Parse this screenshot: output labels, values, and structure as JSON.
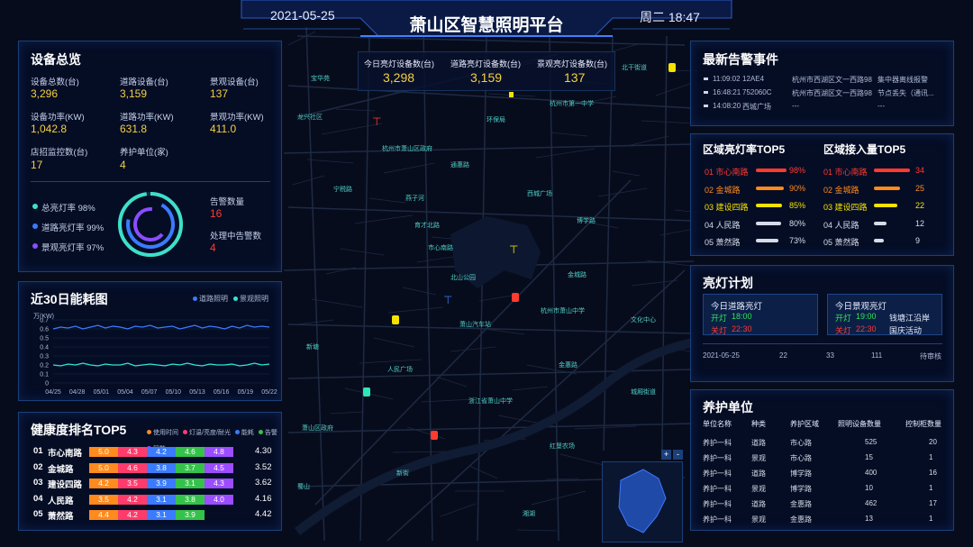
{
  "header": {
    "date": "2021-05-25",
    "title": "萧山区智慧照明平台",
    "weekday_time": "周二 18:47"
  },
  "top_stats": [
    {
      "label": "今日亮灯设备数(台)",
      "value": "3,298"
    },
    {
      "label": "道路亮灯设备数(台)",
      "value": "3,159"
    },
    {
      "label": "景观亮灯设备数(台)",
      "value": "137"
    }
  ],
  "device_overview": {
    "title": "设备总览",
    "items": [
      {
        "label": "设备总数(台)",
        "value": "3,296"
      },
      {
        "label": "道路设备(台)",
        "value": "3,159"
      },
      {
        "label": "景观设备(台)",
        "value": "137"
      },
      {
        "label": "设备功率(KW)",
        "value": "1,042.8"
      },
      {
        "label": "道路功率(KW)",
        "value": "631.8"
      },
      {
        "label": "景观功率(KW)",
        "value": "411.0"
      },
      {
        "label": "店招监控数(台)",
        "value": "17"
      },
      {
        "label": "养护单位(家)",
        "value": "4"
      }
    ],
    "rates": [
      {
        "label": "总亮灯率 98%",
        "color": "#3de0c8"
      },
      {
        "label": "道路亮灯率 99%",
        "color": "#3a7bff"
      },
      {
        "label": "景观亮灯率 97%",
        "color": "#8a4dff"
      }
    ],
    "alarm_count_label": "告警数量",
    "alarm_count": "16",
    "alarm_pending_label": "处理中告警数",
    "alarm_pending": "4"
  },
  "energy": {
    "title": "近30日能耗图",
    "legend": [
      {
        "name": "道路照明",
        "color": "#3a7bff"
      },
      {
        "name": "景观照明",
        "color": "#2ee6d6"
      }
    ],
    "unit": "万(KW)"
  },
  "chart_data": {
    "type": "line",
    "ylabel": "万(KW)",
    "ylim": [
      0,
      0.7
    ],
    "y_ticks": [
      "0.7",
      "0.6",
      "0.5",
      "0.4",
      "0.3",
      "0.2",
      "0.1",
      "0"
    ],
    "x": [
      "04/25",
      "04/28",
      "05/01",
      "05/04",
      "05/07",
      "05/10",
      "05/13",
      "05/16",
      "05/19",
      "05/22"
    ],
    "series": [
      {
        "name": "道路照明",
        "color": "#3a7bff",
        "values": [
          0.6,
          0.62,
          0.61,
          0.63,
          0.6,
          0.62,
          0.64,
          0.61,
          0.63,
          0.62,
          0.6,
          0.63,
          0.62,
          0.64,
          0.61,
          0.62,
          0.63,
          0.6,
          0.62,
          0.64,
          0.61,
          0.63,
          0.62,
          0.6,
          0.63,
          0.61,
          0.64,
          0.62,
          0.63,
          0.62
        ]
      },
      {
        "name": "景观照明",
        "color": "#2ee6d6",
        "values": [
          0.2,
          0.19,
          0.21,
          0.2,
          0.22,
          0.2,
          0.19,
          0.21,
          0.2,
          0.2,
          0.22,
          0.19,
          0.2,
          0.21,
          0.2,
          0.19,
          0.21,
          0.2,
          0.22,
          0.2,
          0.19,
          0.21,
          0.2,
          0.2,
          0.21,
          0.19,
          0.2,
          0.22,
          0.2,
          0.21
        ]
      }
    ]
  },
  "health": {
    "title": "健康度排名TOP5",
    "legend": [
      {
        "name": "使用时间",
        "color": "#ff8a1d"
      },
      {
        "name": "灯温/亮度/耐光",
        "color": "#ff3b6b"
      },
      {
        "name": "能耗",
        "color": "#3a7bff"
      },
      {
        "name": "告警",
        "color": "#35c24a"
      },
      {
        "name": "智能",
        "color": "#9b4dff"
      }
    ],
    "rows": [
      {
        "rank": "01",
        "name": "市心南路",
        "segs": [
          "5.0",
          "4.3",
          "4.2",
          "4.6",
          "4.8"
        ],
        "score": "4.30"
      },
      {
        "rank": "02",
        "name": "金城路",
        "segs": [
          "5.0",
          "4.6",
          "3.8",
          "3.7",
          "4.5"
        ],
        "score": "3.52"
      },
      {
        "rank": "03",
        "name": "建设四路",
        "segs": [
          "4.2",
          "3.5",
          "3.9",
          "3.1",
          "4.3"
        ],
        "score": "3.62"
      },
      {
        "rank": "04",
        "name": "人民路",
        "segs": [
          "3.5",
          "4.2",
          "3.1",
          "3.8",
          "4.0"
        ],
        "score": "4.16"
      },
      {
        "rank": "05",
        "name": "萧然路",
        "segs": [
          "4.4",
          "4.2",
          "3.1",
          "3.9",
          ""
        ],
        "score": "4.42"
      }
    ]
  },
  "alarms": {
    "title": "最新告警事件",
    "rows": [
      {
        "time": "11:09:02",
        "code": "12AE4",
        "addr": "杭州市西湖区文一西路98",
        "desc": "集中器离线报警"
      },
      {
        "time": "16:48:21",
        "code": "752060C",
        "addr": "杭州市西湖区文一西路98",
        "desc": "节点丢失（通讯..."
      },
      {
        "time": "14:08:20",
        "code": "西城广场",
        "addr": "---",
        "desc": "---"
      }
    ]
  },
  "region_light": {
    "title": "区域亮灯率TOP5",
    "rows": [
      {
        "name": "01 市心南路",
        "value": "98%",
        "c": "red"
      },
      {
        "name": "02 金城路",
        "value": "90%",
        "c": "org"
      },
      {
        "name": "03 建设四路",
        "value": "85%",
        "c": "yel"
      },
      {
        "name": "04 人民路",
        "value": "80%",
        "c": "wht"
      },
      {
        "name": "05 萧然路",
        "value": "73%",
        "c": "wht"
      }
    ]
  },
  "region_access": {
    "title": "区域接入量TOP5",
    "rows": [
      {
        "name": "01 市心南路",
        "value": "34",
        "c": "red"
      },
      {
        "name": "02 金城路",
        "value": "25",
        "c": "org"
      },
      {
        "name": "03 建设四路",
        "value": "22",
        "c": "yel"
      },
      {
        "name": "04 人民路",
        "value": "12",
        "c": "wht"
      },
      {
        "name": "05 萧然路",
        "value": "9",
        "c": "wht"
      }
    ]
  },
  "plan": {
    "title": "亮灯计划",
    "road": {
      "title": "今日道路亮灯",
      "on_label": "开灯",
      "on": "18:00",
      "off_label": "关灯",
      "off": "22:30"
    },
    "scenic": {
      "title": "今日景观亮灯",
      "on_label": "开灯",
      "on": "19:00",
      "off_label": "关灯",
      "off": "22:30",
      "note1": "钱塘江沿岸",
      "note2": "国庆活动"
    },
    "row": {
      "date": "2021-05-25",
      "a": "22",
      "b": "33",
      "c": "111",
      "status": "待审核"
    }
  },
  "maint": {
    "title": "养护单位",
    "headers": [
      "单位名称",
      "种类",
      "养护区域",
      "照明设备数量",
      "控制柜数量"
    ],
    "rows": [
      [
        "养护一科",
        "道路",
        "市心路",
        "525",
        "20"
      ],
      [
        "养护一科",
        "景观",
        "市心路",
        "15",
        "1"
      ],
      [
        "养护一科",
        "道路",
        "博学路",
        "400",
        "16"
      ],
      [
        "养护一科",
        "景观",
        "博学路",
        "10",
        "1"
      ],
      [
        "养护一科",
        "道路",
        "金惠路",
        "462",
        "17"
      ],
      [
        "养护一科",
        "景观",
        "金惠路",
        "13",
        "1"
      ]
    ]
  },
  "map_labels": [
    "宝华苑",
    "龙兴社区",
    "环保局",
    "杭州市萧山区政府",
    "通惠路",
    "宁税路",
    "西城广场",
    "燕子河",
    "育才北路",
    "市心南路",
    "北山公园",
    "金城路",
    "杭州市萧山中学",
    "萧山汽车站",
    "人民广场",
    "文化中心",
    "新塘",
    "浙江省萧山中学",
    "红垦农场",
    "新街",
    "萧山区政府",
    "蜀山",
    "湘湖",
    "博学路",
    "金惠路",
    "城厢街道",
    "北干街道",
    "杭州市第一中学"
  ],
  "map_zoom": [
    "+",
    "-"
  ]
}
